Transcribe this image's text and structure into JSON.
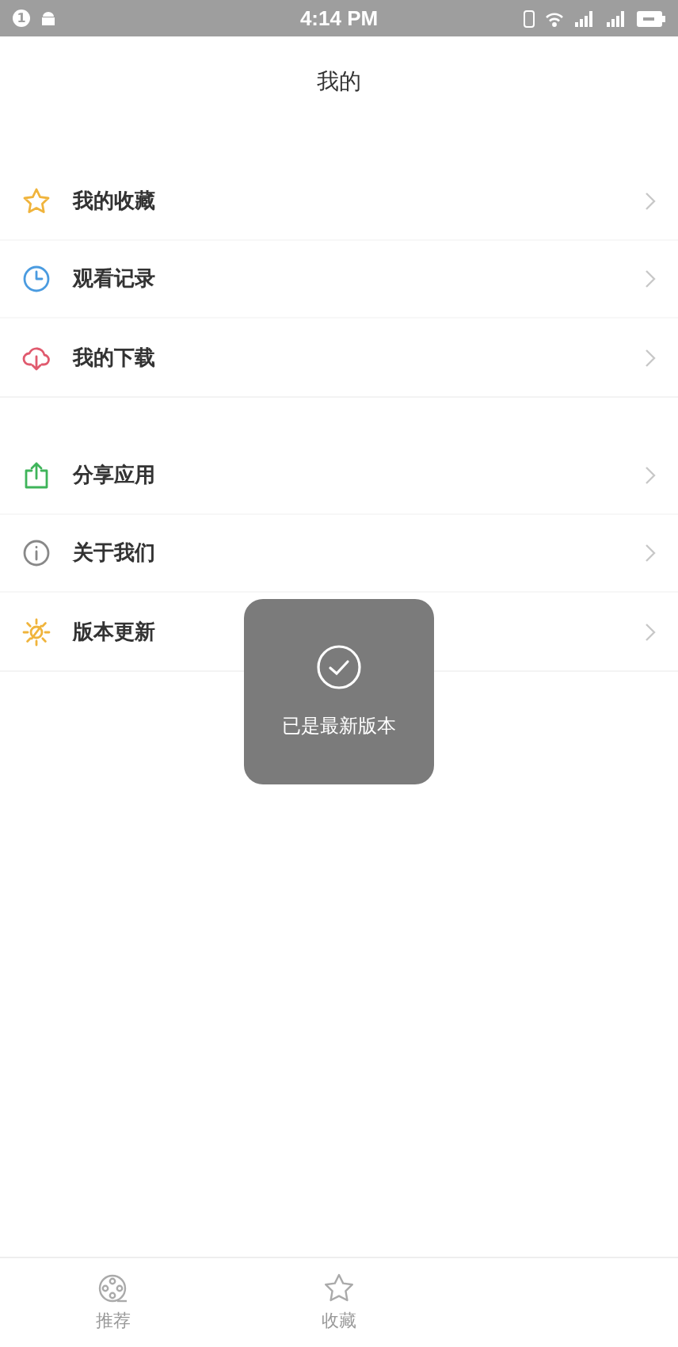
{
  "status_bar": {
    "time": "4:14 PM",
    "notification_count": "1"
  },
  "header": {
    "title": "我的"
  },
  "menu_groups": [
    {
      "items": [
        {
          "label": "我的收藏",
          "kind": "star",
          "color": "#f0b43c"
        },
        {
          "label": "观看记录",
          "kind": "clock",
          "color": "#4a9be0"
        },
        {
          "label": "我的下载",
          "kind": "download",
          "color": "#e05a6e"
        }
      ]
    },
    {
      "items": [
        {
          "label": "分享应用",
          "kind": "share",
          "color": "#3fb45a"
        },
        {
          "label": "关于我们",
          "kind": "info",
          "color": "#888888"
        },
        {
          "label": "版本更新",
          "kind": "update",
          "color": "#f0b43c"
        }
      ]
    }
  ],
  "toast": {
    "message": "已是最新版本"
  },
  "tab_bar": [
    {
      "label": "推荐",
      "kind": "film",
      "selected": false
    },
    {
      "label": "收藏",
      "kind": "star",
      "selected": false
    }
  ]
}
